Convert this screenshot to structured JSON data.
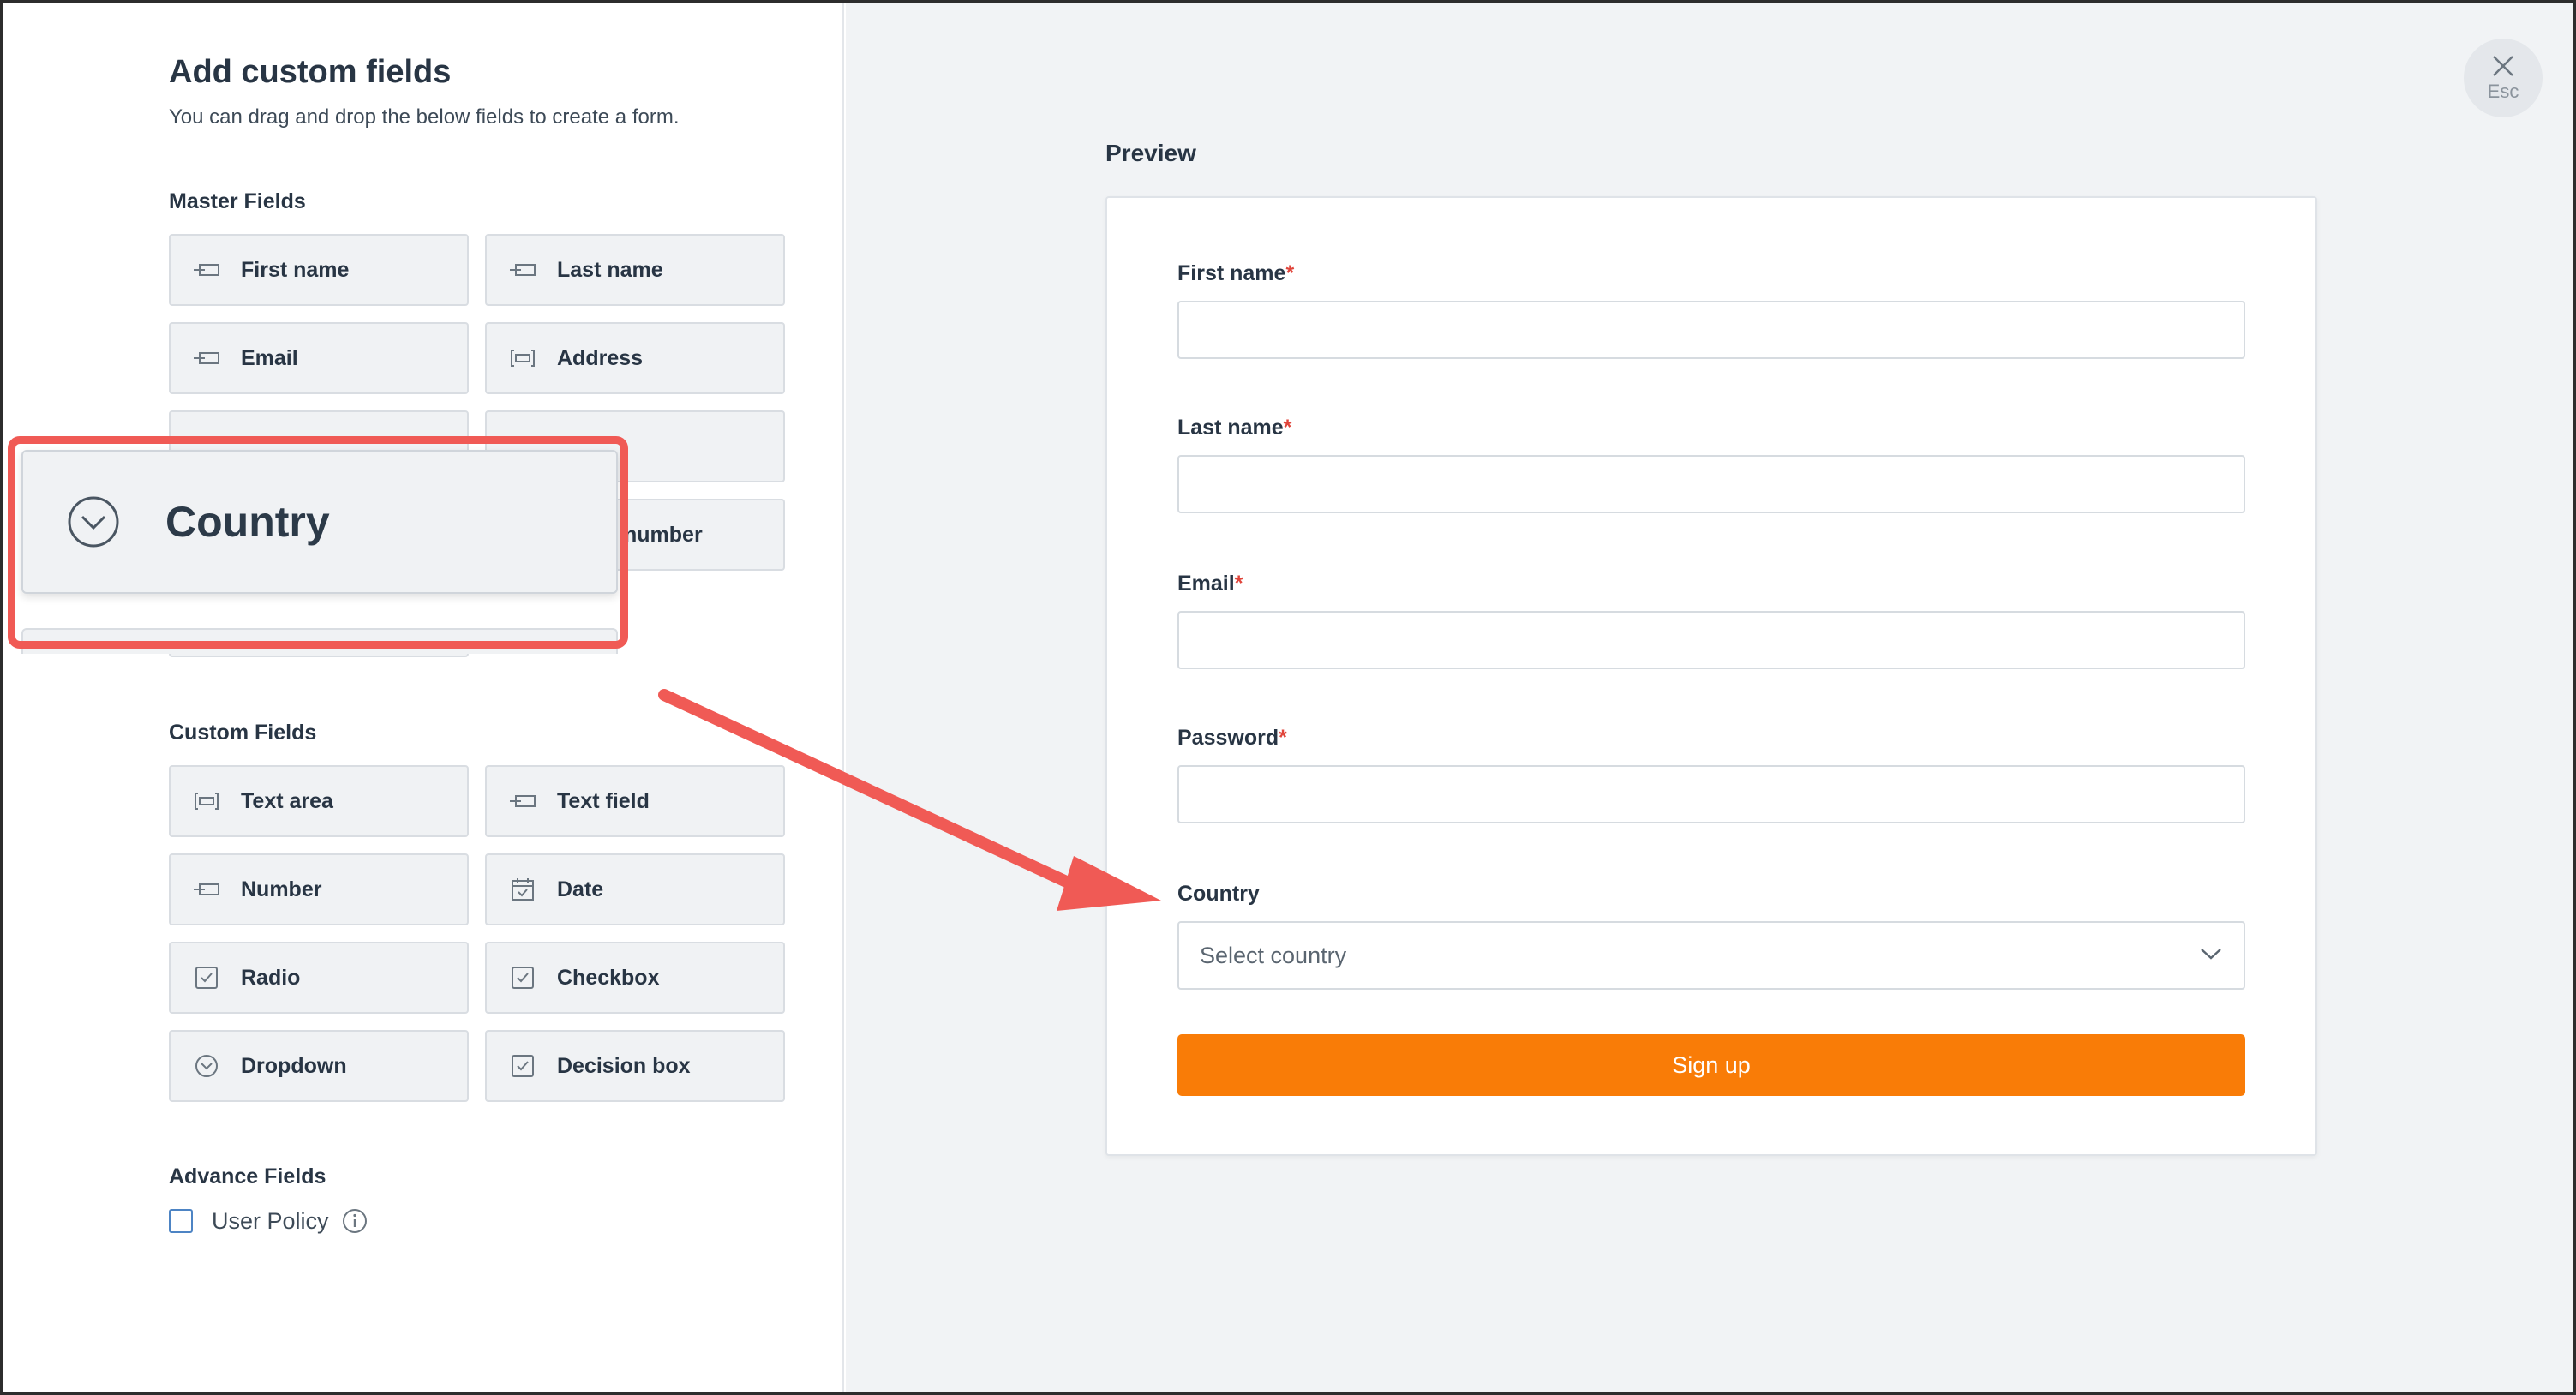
{
  "header": {
    "title": "Add custom fields",
    "subtitle": "You can drag and drop the below fields to create a form."
  },
  "master_fields": {
    "label": "Master Fields",
    "items": [
      {
        "label": "First name",
        "icon": "text-field-icon"
      },
      {
        "label": "Last name",
        "icon": "text-field-icon"
      },
      {
        "label": "Email",
        "icon": "text-field-icon"
      },
      {
        "label": "Address",
        "icon": "text-area-icon"
      },
      {
        "label": "number",
        "icon": "text-field-icon"
      }
    ]
  },
  "drag_ghost": {
    "label": "Country",
    "icon": "dropdown-icon"
  },
  "custom_fields": {
    "label": "Custom Fields",
    "items": [
      {
        "label": "Text area",
        "icon": "text-area-icon"
      },
      {
        "label": "Text field",
        "icon": "text-field-icon"
      },
      {
        "label": "Number",
        "icon": "text-field-icon"
      },
      {
        "label": "Date",
        "icon": "calendar-icon"
      },
      {
        "label": "Radio",
        "icon": "checkbox-icon"
      },
      {
        "label": "Checkbox",
        "icon": "checkbox-icon"
      },
      {
        "label": "Dropdown",
        "icon": "dropdown-icon"
      },
      {
        "label": "Decision box",
        "icon": "checkbox-icon"
      }
    ]
  },
  "advance_fields": {
    "label": "Advance Fields",
    "user_policy": {
      "label": "User Policy",
      "checked": false
    }
  },
  "close": {
    "label": "Esc"
  },
  "preview": {
    "title": "Preview",
    "fields": [
      {
        "label": "First name",
        "required": "*"
      },
      {
        "label": "Last name",
        "required": "*"
      },
      {
        "label": "Email",
        "required": "*"
      },
      {
        "label": "Password",
        "required": "*"
      }
    ],
    "country": {
      "label": "Country",
      "placeholder": "Select country"
    },
    "submit_label": "Sign up"
  },
  "colors": {
    "accent": "#f97c07",
    "highlight": "#f05a55",
    "required": "#e0453b"
  }
}
